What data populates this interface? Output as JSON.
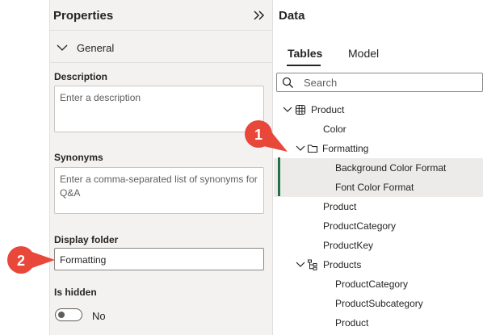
{
  "properties": {
    "title": "Properties",
    "section": "General",
    "description_label": "Description",
    "description_placeholder": "Enter a description",
    "synonyms_label": "Synonyms",
    "synonyms_placeholder": "Enter a comma-separated list of synonyms for Q&A",
    "display_folder_label": "Display folder",
    "display_folder_value": "Formatting",
    "is_hidden_label": "Is hidden",
    "is_hidden_value": "No"
  },
  "callouts": [
    "1",
    "2"
  ],
  "colors": {
    "callout": "#e8473a",
    "accent": "#217346",
    "selected_row": "#edebe9"
  },
  "data_pane": {
    "title": "Data",
    "tabs": [
      "Tables",
      "Model"
    ],
    "active_tab": "Tables",
    "search_placeholder": "Search",
    "tree": [
      {
        "label": "Product",
        "icon": "table-icon",
        "expanded": true
      },
      {
        "label": "Color"
      },
      {
        "label": "Formatting",
        "icon": "folder-icon",
        "expanded": true
      },
      {
        "label": "Background Color Format",
        "selected": true
      },
      {
        "label": "Font Color Format",
        "selected": true
      },
      {
        "label": "Product"
      },
      {
        "label": "ProductCategory"
      },
      {
        "label": "ProductKey"
      },
      {
        "label": "Products",
        "icon": "hierarchy-icon",
        "expanded": true
      },
      {
        "label": "ProductCategory"
      },
      {
        "label": "ProductSubcategory"
      },
      {
        "label": "Product"
      }
    ]
  }
}
